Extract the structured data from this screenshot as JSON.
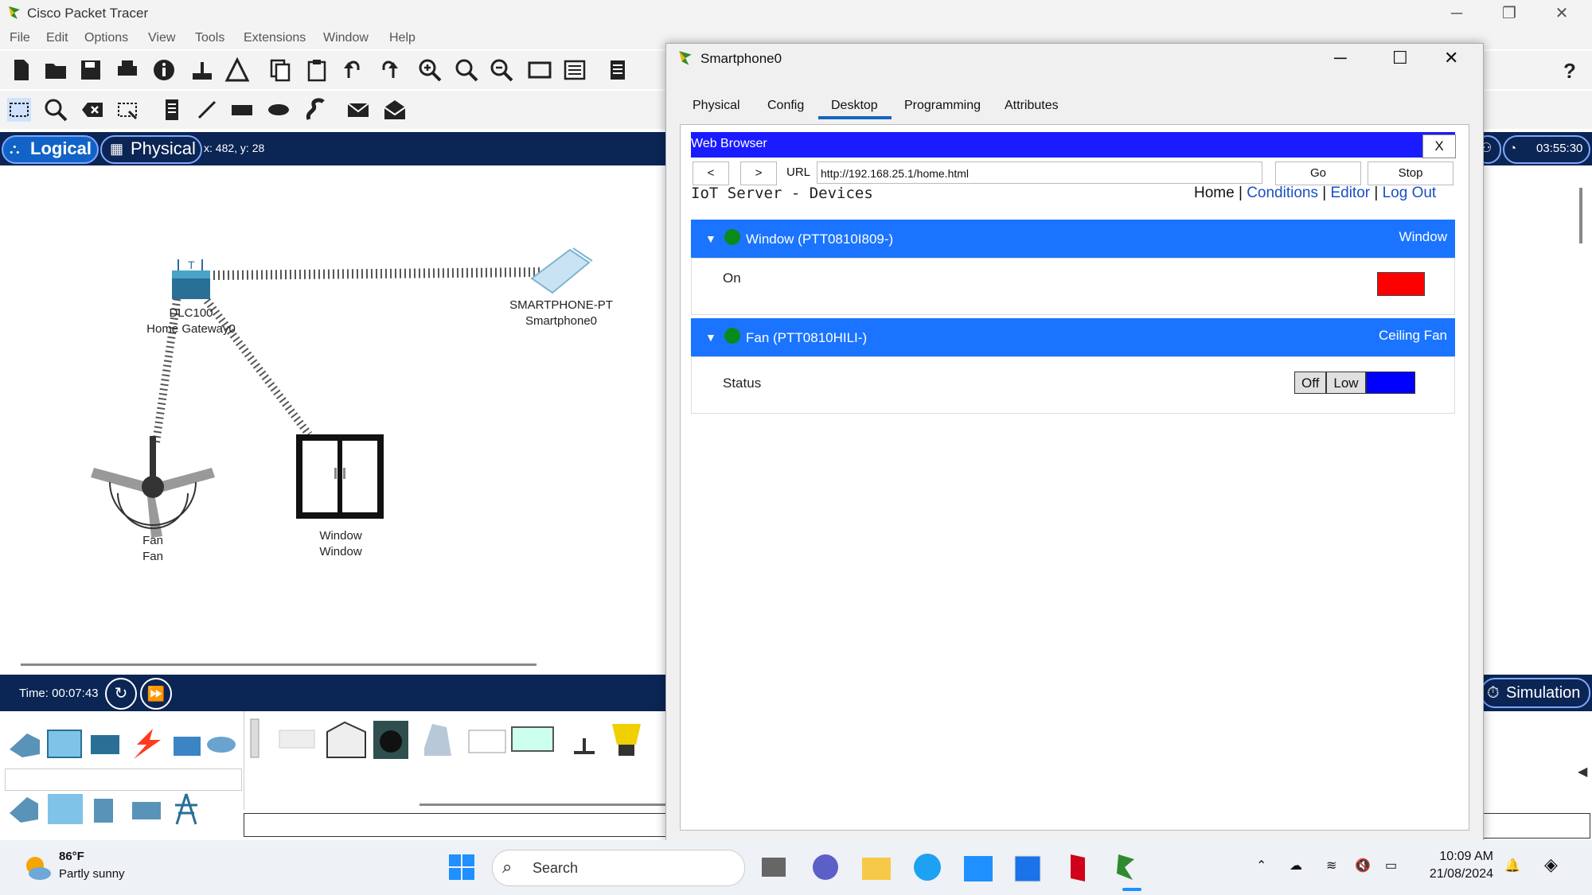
{
  "app": {
    "title": "Cisco Packet Tracer"
  },
  "menu": [
    "File",
    "Edit",
    "Options",
    "View",
    "Tools",
    "Extensions",
    "Window",
    "Help"
  ],
  "view": {
    "logical": "Logical",
    "physical": "Physical",
    "coords": "x: 482, y: 28",
    "clock": "03:55:30",
    "mode": "Simulation"
  },
  "devices": [
    {
      "model": "DLC100",
      "name": "Home Gateway0"
    },
    {
      "model": "SMARTPHONE-PT",
      "name": "Smartphone0"
    },
    {
      "model": "Fan",
      "name": "Fan"
    },
    {
      "model": "Window",
      "name": "Window"
    }
  ],
  "time": {
    "label": "Time: 00:07:43"
  },
  "dialog": {
    "title": "Smartphone0",
    "tabs": [
      "Physical",
      "Config",
      "Desktop",
      "Programming",
      "Attributes"
    ],
    "active_tab": "Desktop"
  },
  "browser": {
    "title": "Web Browser",
    "close": "X",
    "back": "<",
    "forward": ">",
    "url_label": "URL",
    "url": "http://192.168.25.1/home.html",
    "go": "Go",
    "stop": "Stop",
    "page_title": "IoT Server - Devices",
    "links": {
      "home": "Home",
      "conditions": "Conditions",
      "editor": "Editor",
      "logout": "Log Out",
      "sep": "|"
    }
  },
  "iot_devices": [
    {
      "name": "Window (PTT0810I809-)",
      "type": "Window",
      "prop": "On",
      "status_color": "#ff0000"
    },
    {
      "name": "Fan (PTT0810HILI-)",
      "type": "Ceiling Fan",
      "prop": "Status",
      "options": [
        "Off",
        "Low"
      ],
      "selected_color": "#0000ff"
    }
  ],
  "taskbar": {
    "weather_temp": "86°F",
    "weather_desc": "Partly sunny",
    "search": "Search",
    "time": "10:09 AM",
    "date": "21/08/2024"
  }
}
